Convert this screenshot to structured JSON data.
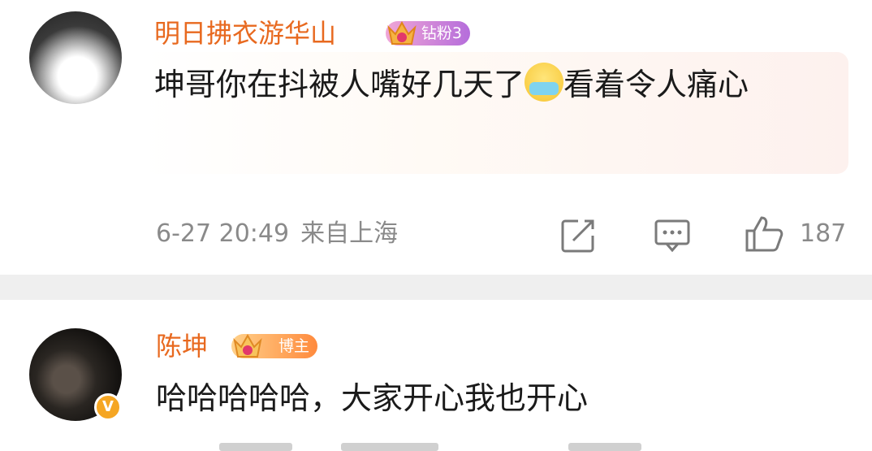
{
  "comments": [
    {
      "username": "明日拂衣游华山",
      "badge": {
        "level": "7",
        "label": "钻粉3",
        "color": "#b56ddb"
      },
      "text_before_emoji": "坤哥你在抖被人嘴好几天了",
      "emoji": "mask-emoji",
      "text_after_emoji": "看着令人痛心",
      "timestamp": "6-27 20:49",
      "location": "来自上海",
      "likes": "187",
      "icons": [
        "share-icon",
        "comment-icon",
        "like-icon"
      ]
    },
    {
      "username": "陈坤",
      "badge": {
        "level": "9",
        "label": "博主",
        "color": "#ff8a3d"
      },
      "text": "哈哈哈哈哈，大家开心我也开心",
      "verified": "V"
    }
  ],
  "colors": {
    "username": "#e8691f",
    "meta": "#8a8a8a",
    "divider": "#efefef"
  }
}
